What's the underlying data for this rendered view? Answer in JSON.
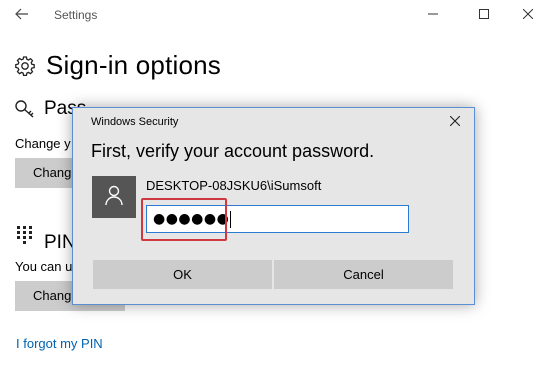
{
  "window": {
    "title": "Settings",
    "back_icon": "arrow-left-icon",
    "controls": [
      "minimize-icon",
      "maximize-icon",
      "close-icon"
    ]
  },
  "page": {
    "title": "Sign-in options",
    "icon": "gear-icon"
  },
  "sections": {
    "password": {
      "title": "Password",
      "title_visible": "Pass",
      "icon": "key-icon",
      "description_visible": "Change y",
      "button_visible": "Chang"
    },
    "pin": {
      "title": "PIN",
      "icon": "keypad-icon",
      "description_visible": "You can u",
      "button_visible": "Chang"
    }
  },
  "links": {
    "forgot_pin": "I forgot my PIN"
  },
  "dialog": {
    "title": "Windows Security",
    "heading": "First, verify your account password.",
    "account": "DESKTOP-08JSKU6\\iSumsoft",
    "password_masked": "●●●●●●",
    "ok_label": "OK",
    "cancel_label": "Cancel",
    "user_icon": "user-icon",
    "highlight_color": "#d0383f"
  },
  "colors": {
    "link": "#0063b1",
    "dialog_bg": "#e6e6e6",
    "input_border": "#2c7bd2",
    "button_bg": "#cccccc"
  }
}
